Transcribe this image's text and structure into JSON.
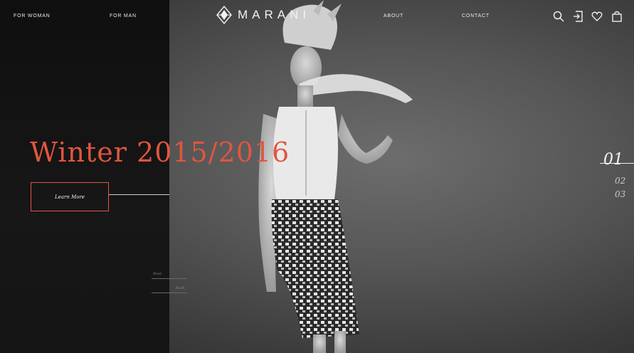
{
  "nav": {
    "for_woman": "FOR WOMAN",
    "for_man": "FOR MAN",
    "about": "ABOUT",
    "contact": "CONTACT"
  },
  "brand": {
    "name": "MARANI"
  },
  "icons": [
    "search-icon",
    "login-icon",
    "heart-icon",
    "shopping-bag-icon"
  ],
  "hero": {
    "title": "Winter 2015/2016",
    "cta_label": "Learn More",
    "next_label": "Next",
    "back_label": "Back"
  },
  "slider": {
    "active": "01",
    "second": "02",
    "third": "03"
  },
  "colors": {
    "accent": "#e2553f",
    "panel": "#141414",
    "background": "#555555"
  }
}
